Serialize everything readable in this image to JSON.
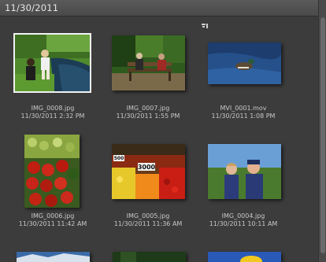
{
  "header": {
    "date": "11/30/2011"
  },
  "items": [
    {
      "name": "IMG_0008.jpg",
      "date": "11/30/2011 2:32 PM",
      "selected": true,
      "thumb": "park-children"
    },
    {
      "name": "IMG_0007.jpg",
      "date": "11/30/2011 1:55 PM",
      "selected": false,
      "thumb": "park-bench"
    },
    {
      "name": "MVI_0001.mov",
      "date": "11/30/2011 1:08 PM",
      "selected": false,
      "thumb": "duck-water"
    },
    {
      "name": "IMG_0006.jpg",
      "date": "11/30/2011 11:42 AM",
      "selected": false,
      "thumb": "tomatoes"
    },
    {
      "name": "IMG_0005.jpg",
      "date": "11/30/2011 11:36 AM",
      "selected": false,
      "thumb": "fruit-market"
    },
    {
      "name": "IMG_0004.jpg",
      "date": "11/30/2011 10:11 AM",
      "selected": false,
      "thumb": "couple-portrait"
    }
  ],
  "partial_row": [
    "mountains",
    "forest",
    "sunflower"
  ],
  "sort_icon": "sort-indicator-icon"
}
